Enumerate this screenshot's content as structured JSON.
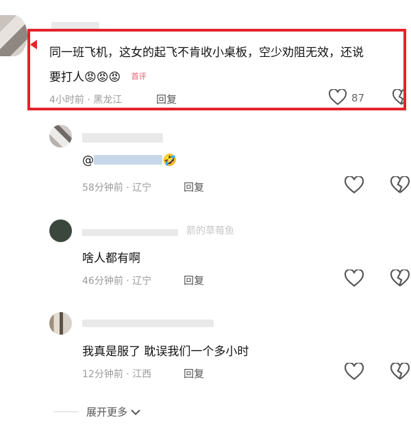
{
  "comments": [
    {
      "text_line1": "同一班飞机，这女的起飞不肯收小桌板，空少劝阻无效，还说",
      "text_line2": "要打人",
      "emoji": "😡😡😡",
      "tag": "首评",
      "time": "4小时前",
      "location": "黑龙江",
      "reply_label": "回复",
      "like_count": "87"
    },
    {
      "mention": "@",
      "emoji": "🤣",
      "time": "58分钟前",
      "location": "辽宁",
      "reply_label": "回复"
    },
    {
      "partial_name": "箭的草莓鱼",
      "text": "啥人都有啊",
      "time": "46分钟前",
      "location": "辽宁",
      "reply_label": "回复"
    },
    {
      "text": "我真是服了 耽误我们一个多小时",
      "time": "12分钟前",
      "location": "江西",
      "reply_label": "回复"
    }
  ],
  "expand_more": "展开更多",
  "meta_separator": "·"
}
